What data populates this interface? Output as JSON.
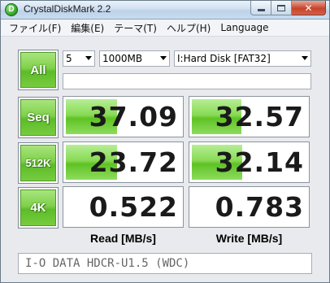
{
  "window": {
    "title": "CrystalDiskMark 2.2",
    "icon_letter": "D"
  },
  "menu": [
    "ファイル(F)",
    "編集(E)",
    "テーマ(T)",
    "ヘルプ(H)",
    "Language"
  ],
  "controls": {
    "all_label": "All",
    "count": "5",
    "size": "1000MB",
    "drive": "I:Hard Disk [FAT32]"
  },
  "tests": [
    {
      "label": "Seq",
      "read": "37.09",
      "write": "32.57",
      "read_level": 0.45,
      "write_level": 0.43
    },
    {
      "label": "512K",
      "read": "23.72",
      "write": "32.14",
      "read_level": 0.45,
      "write_level": 0.44
    },
    {
      "label": "4K",
      "read": "0.522",
      "write": "0.783",
      "read_level": 0.0,
      "write_level": 0.0
    }
  ],
  "columns": {
    "read": "Read [MB/s]",
    "write": "Write [MB/s]"
  },
  "drive_info": "I-O DATA HDCR-U1.5 (WDC)",
  "colors": {
    "accent_green": "#5cbc28",
    "bar_green": "#88da55"
  }
}
